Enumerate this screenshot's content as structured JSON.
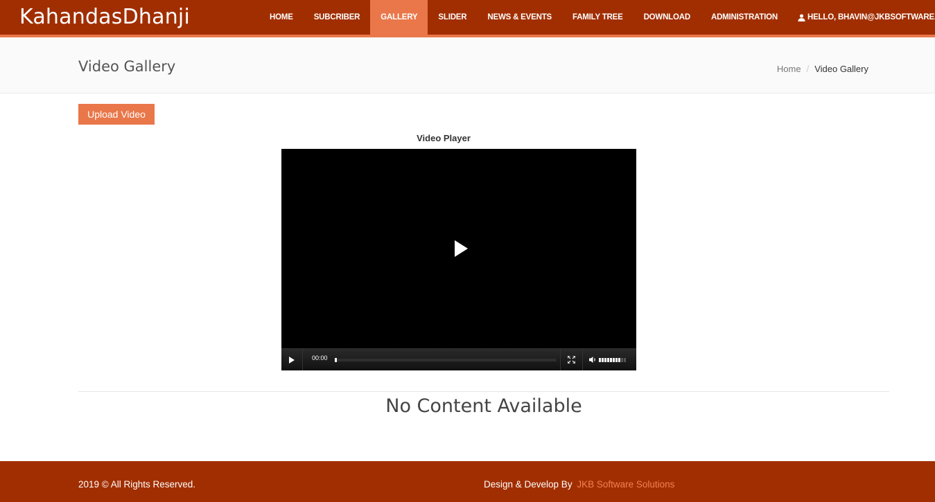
{
  "header": {
    "brand": "KahandasDhanji",
    "nav": [
      "HOME",
      "SUBCRIBER",
      "GALLERY",
      "SLIDER",
      "NEWS & EVENTS",
      "FAMILY TREE",
      "DOWNLOAD",
      "ADMINISTRATION"
    ],
    "active_nav": "GALLERY",
    "user_label": "HELLO, BHAVIN@JKBSOFTWARE.COM"
  },
  "page": {
    "title": "Video Gallery",
    "breadcrumb": {
      "home": "Home",
      "separator": "/",
      "current": "Video Gallery"
    }
  },
  "content": {
    "upload_button": "Upload Video",
    "player_label": "Video Player",
    "player": {
      "current_time": "00:00",
      "progress": 0,
      "volume": 0.8
    },
    "empty_message": "No Content Available"
  },
  "footer": {
    "copyright": "2019 © All Rights Reserved.",
    "design_prefix": "Design & Develop By",
    "design_link": "JKB Software Solutions"
  },
  "colors": {
    "header_bg": "#a12e00",
    "accent": "#e9774a",
    "footer_link": "#f0824f"
  },
  "icons": {
    "user": "user-icon",
    "dropdown": "chevron-down-icon",
    "play": "play-icon",
    "fullscreen": "fullscreen-icon",
    "volume": "volume-icon"
  }
}
